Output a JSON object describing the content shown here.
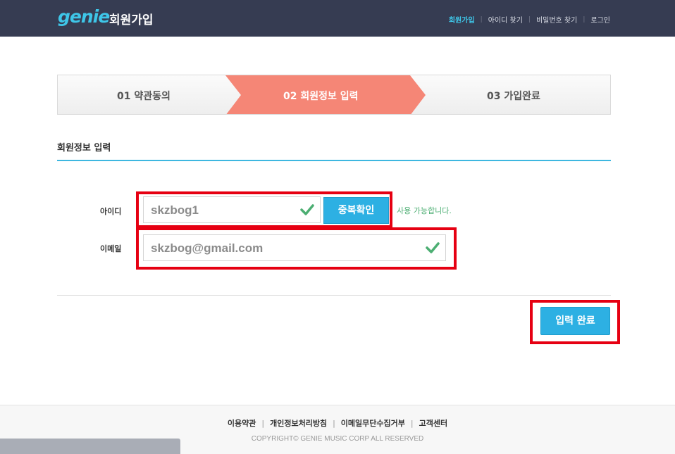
{
  "header": {
    "logo": "genie",
    "title": "회원가입",
    "nav": [
      "회원가입",
      "아이디 찾기",
      "비밀번호 찾기",
      "로그인"
    ],
    "nav_separator": "|",
    "accent_color": "#3ec6e8",
    "background_color": "#363c52"
  },
  "steps": {
    "items": [
      "01 약관동의",
      "02 회원정보 입력",
      "03 가입완료"
    ],
    "active_index": 1,
    "active_color": "#f58676"
  },
  "section": {
    "title": "회원정보 입력"
  },
  "form": {
    "id_label": "아이디",
    "id_value": "skzbog1",
    "duplicate_check_label": "중복확인",
    "availability_message": "사용 가능합니다.",
    "email_label": "이메일",
    "email_value": "skzbog@gmail.com",
    "submit_label": "입력 완료",
    "button_color": "#2db0e3",
    "check_icon": "check-icon",
    "check_color": "#4cae72"
  },
  "footer": {
    "links": [
      "이용약관",
      "개인정보처리방침",
      "이메일무단수집거부",
      "고객센터"
    ],
    "separator": "|",
    "copyright": "COPYRIGHT© GENIE MUSIC CORP ALL RESERVED"
  },
  "highlight_color": "#e60012"
}
